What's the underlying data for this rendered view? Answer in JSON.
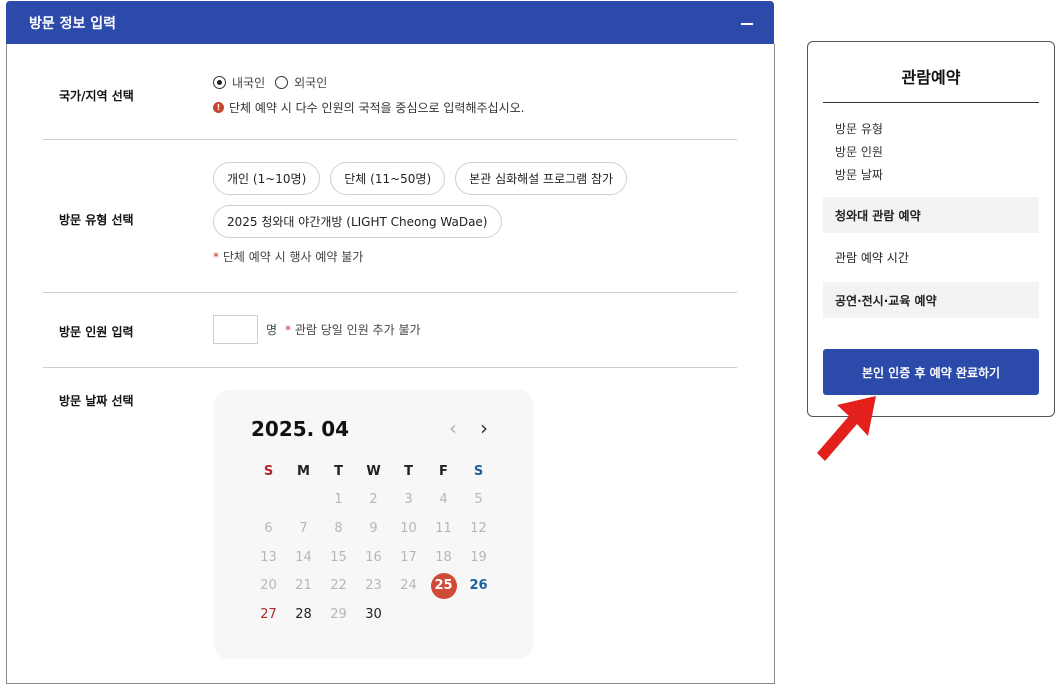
{
  "panel": {
    "title": "방문 정보 입력"
  },
  "country": {
    "label": "국가/지역 선택",
    "options": [
      "내국인",
      "외국인"
    ],
    "selected": "내국인",
    "notice": "단체 예약 시 다수 인원의 국적을 중심으로 입력해주십시오."
  },
  "visit_type": {
    "label": "방문 유형 선택",
    "chips": [
      "개인 (1~10명)",
      "단체 (11~50명)",
      "본관 심화해설 프로그램 참가",
      "2025 청와대 야간개방 (LIGHT Cheong WaDae)"
    ],
    "note": "단체 예약 시 행사 예약 불가"
  },
  "visitors": {
    "label": "방문 인원 입력",
    "unit": "명",
    "value": "",
    "note": "관람 당일 인원 추가 불가"
  },
  "date": {
    "label": "방문 날짜 선택",
    "calendar_title": "2025. 04",
    "prev": "‹",
    "next": "›",
    "weekdays": [
      "S",
      "M",
      "T",
      "W",
      "T",
      "F",
      "S"
    ],
    "selected_day": "25"
  },
  "sidebar": {
    "title": "관람예약",
    "info": [
      "방문 유형",
      "방문 인원",
      "방문 날짜"
    ],
    "items": [
      "청와대 관람 예약",
      "관람 예약 시간",
      "공연·전시·교육 예약"
    ],
    "button": "본인 인증 후 예약 완료하기"
  },
  "colors": {
    "primary": "#2b4aa9",
    "accent_red": "#d04a35",
    "sunday": "#b02a2a",
    "saturday": "#1f5fa0",
    "arrow": "#e3201b"
  },
  "icons": {
    "collapse": "minus-icon",
    "info": "info-icon",
    "arrow": "red-arrow-icon"
  }
}
